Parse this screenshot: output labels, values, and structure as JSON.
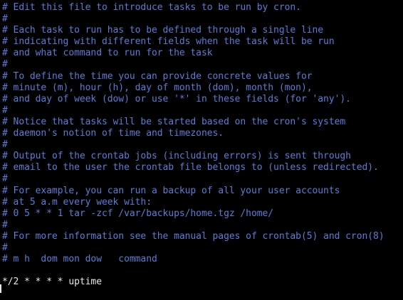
{
  "editor": {
    "lines": [
      "# Edit this file to introduce tasks to be run by cron.",
      "#",
      "# Each task to run has to be defined through a single line",
      "# indicating with different fields when the task will be run",
      "# and what command to run for the task",
      "#",
      "# To define the time you can provide concrete values for",
      "# minute (m), hour (h), day of month (dom), month (mon),",
      "# and day of week (dow) or use '*' in these fields (for 'any').",
      "#",
      "# Notice that tasks will be started based on the cron's system",
      "# daemon's notion of time and timezones.",
      "#",
      "# Output of the crontab jobs (including errors) is sent through",
      "# email to the user the crontab file belongs to (unless redirected).",
      "#",
      "# For example, you can run a backup of all your user accounts",
      "# at 5 a.m every week with:",
      "# 0 5 * * 1 tar -zcf /var/backups/home.tgz /home/",
      "#",
      "# For more information see the manual pages of crontab(5) and cron(8)",
      "#",
      "# m h  dom mon dow   command",
      "",
      "*/2 * * * * uptime"
    ]
  },
  "colors": {
    "background": "#000000",
    "comment": "#5c7cd6",
    "text": "#e8e8e8"
  }
}
